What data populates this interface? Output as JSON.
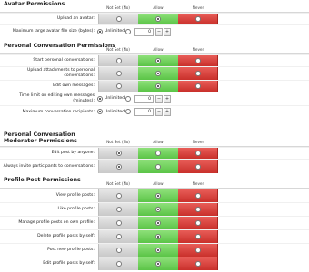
{
  "columns": {
    "not_set": "Not Set (No)",
    "allow": "Allow",
    "never": "Never"
  },
  "radio_options": {
    "unlimited": "Unlimited"
  },
  "stepper": {
    "dec": "−",
    "inc": "+"
  },
  "sections": {
    "avatar": {
      "title": "Avatar Permissions",
      "upload_avatar": {
        "label": "Upload an avatar:",
        "selected": "allow"
      },
      "max_size": {
        "label": "Maximum large avatar file size (bytes):",
        "selected": "unlimited",
        "value": "0"
      }
    },
    "conversation": {
      "title": "Personal Conversation Permissions",
      "start": {
        "label": "Start personal conversations:",
        "selected": "allow"
      },
      "upload_attach": {
        "label": "Upload attachments to personal conversations:",
        "selected": "allow"
      },
      "edit_own": {
        "label": "Edit own messages:",
        "selected": "allow"
      },
      "time_limit": {
        "label": "Time limit on editing own messages (minutes):",
        "selected": "unlimited",
        "value": "0"
      },
      "max_recipients": {
        "label": "Maximum conversation recipients:",
        "selected": "unlimited",
        "value": "0"
      }
    },
    "moderator": {
      "title": "Personal Conversation Moderator Permissions",
      "edit_any": {
        "label": "Edit post by anyone:",
        "selected": "not_set"
      },
      "always_invite": {
        "label": "Always invite participants to conversations:",
        "selected": "not_set"
      }
    },
    "profile": {
      "title": "Profile Post Permissions",
      "view": {
        "label": "View profile posts:",
        "selected": "allow"
      },
      "like": {
        "label": "Like profile posts:",
        "selected": "allow"
      },
      "manage_own": {
        "label": "Manage profile posts on own profile:",
        "selected": "allow"
      },
      "delete_self": {
        "label": "Delete profile posts by self:",
        "selected": "allow"
      },
      "post_new": {
        "label": "Post new profile posts:",
        "selected": "allow"
      },
      "edit_self": {
        "label": "Edit profile posts by self:",
        "selected": "allow"
      }
    }
  },
  "colors": {
    "allow": "#5bc447",
    "never": "#c9302b",
    "not_set": "#d0d0d0"
  }
}
